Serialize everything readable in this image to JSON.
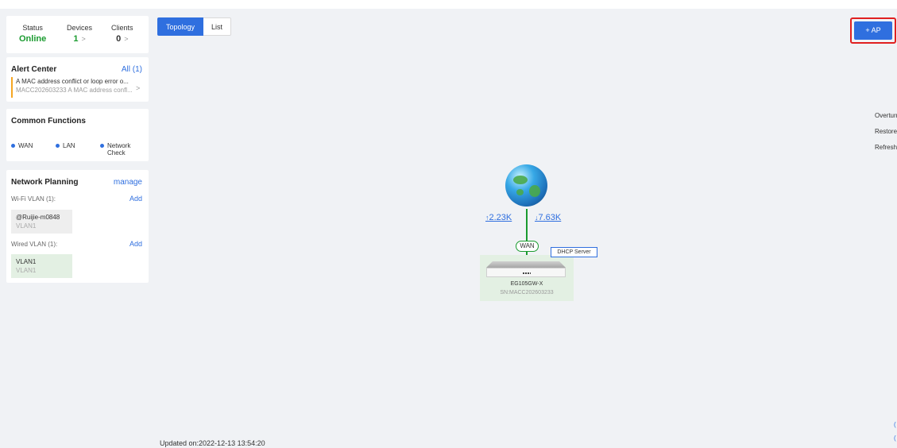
{
  "status": {
    "status_label": "Status",
    "status_value": "Online",
    "devices_label": "Devices",
    "devices_value": "1",
    "clients_label": "Clients",
    "clients_value": "0",
    "chevron": ">"
  },
  "alert_center": {
    "title": "Alert Center",
    "all_link": "All (1)",
    "item_line1": "A MAC address conflict or loop error o...",
    "item_line2": "MACC202603233 A MAC address confl...",
    "chevron": ">"
  },
  "common_functions": {
    "title": "Common Functions",
    "items": [
      "WAN",
      "LAN",
      "Network",
      "Check"
    ]
  },
  "network_planning": {
    "title": "Network Planning",
    "manage_link": "manage",
    "wifi_vlan_label": "Wi-Fi VLAN (1):",
    "wifi_add": "Add",
    "wifi_entry_name": "@Ruijie-m0848",
    "wifi_entry_vlan": "VLAN1",
    "wired_vlan_label": "Wired VLAN (1):",
    "wired_add": "Add",
    "wired_entry_name": "VLAN1",
    "wired_entry_vlan": "VLAN1"
  },
  "view_tabs": {
    "topology": "Topology",
    "list": "List"
  },
  "toolbar": {
    "add_ap": "+ AP"
  },
  "side_actions": {
    "overturn": "Overturn",
    "restore": "Restore",
    "refresh": "Refresh"
  },
  "topology": {
    "upload_arrow": "↑",
    "upload": "2.23K",
    "download_arrow": "↓",
    "download": "7.63K",
    "wan_label": "WAN",
    "dhcp_label": "DHCP Server",
    "device_model": "EG105GW-X",
    "device_sn": "SN:MACC202603233"
  },
  "footer": {
    "updated": "Updated on:2022-12-13 13:54:20"
  },
  "colors": {
    "accent": "#2f6fdf",
    "online": "#1a9b2f",
    "alert": "#f5a623",
    "highlight": "#e02020"
  }
}
